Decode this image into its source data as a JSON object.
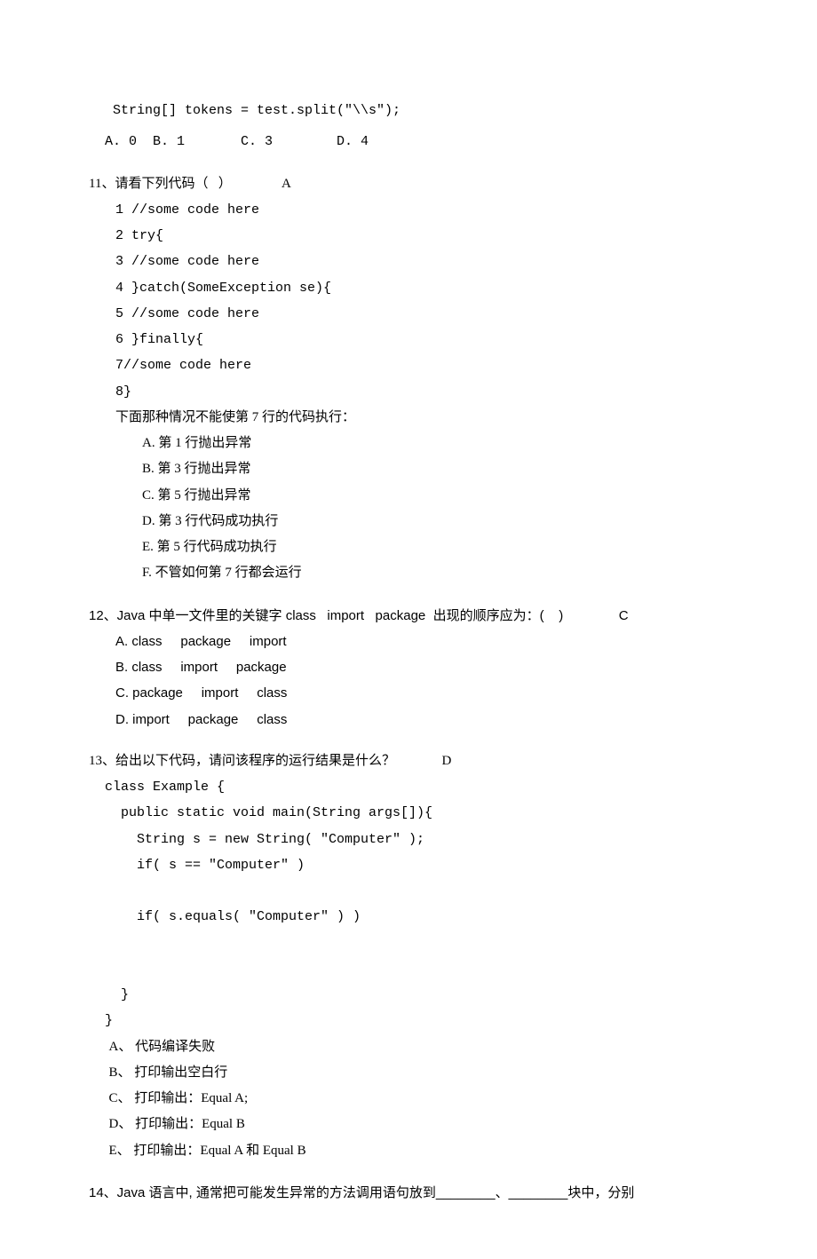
{
  "top": {
    "code": "   String[] tokens = test.split(\"\\\\s\");",
    "options": "  A. 0  B. 1       C. 3        D. 4"
  },
  "q11": {
    "title": "11、请看下列代码（   ）               A",
    "code": [
      "1 //some code here",
      "2 try{",
      "3 //some code here",
      "4 }catch(SomeException se){",
      "5 //some code here",
      "6 }finally{",
      "7//some code here",
      "8}"
    ],
    "prompt": "下面那种情况不能使第 7 行的代码执行：",
    "opts": [
      "A. 第 1 行抛出异常",
      "B. 第 3 行抛出异常",
      "C. 第 5 行抛出异常",
      "D. 第 3 行代码成功执行",
      "E. 第 5 行代码成功执行",
      "F. 不管如何第 7 行都会运行"
    ]
  },
  "q12": {
    "title": "12、Java 中单一文件里的关键字 class   import   package  出现的顺序应为：(    )               C",
    "opts": [
      "A. class     package     import",
      "B. class     import     package",
      "C. package     import     class",
      "D. import     package     class"
    ]
  },
  "q13": {
    "title": "13、给出以下代码，请问该程序的运行结果是什么？              D",
    "code": [
      "  class Example {",
      "    public static void main(String args[]){",
      "      String s = new String( \"Computer\" );",
      "      if( s == \"Computer\" )",
      "",
      "      if( s.equals( \"Computer\" ) )",
      "",
      "",
      "    }",
      "  }"
    ],
    "opts": [
      "A、 代码编译失败",
      "B、 打印输出空白行",
      "C、 打印输出：Equal A;",
      "D、 打印输出：Equal B",
      "E、 打印输出：Equal A 和 Equal B"
    ]
  },
  "q14": {
    "text": "14、Java 语言中, 通常把可能发生异常的方法调用语句放到________、________块中，分别"
  }
}
